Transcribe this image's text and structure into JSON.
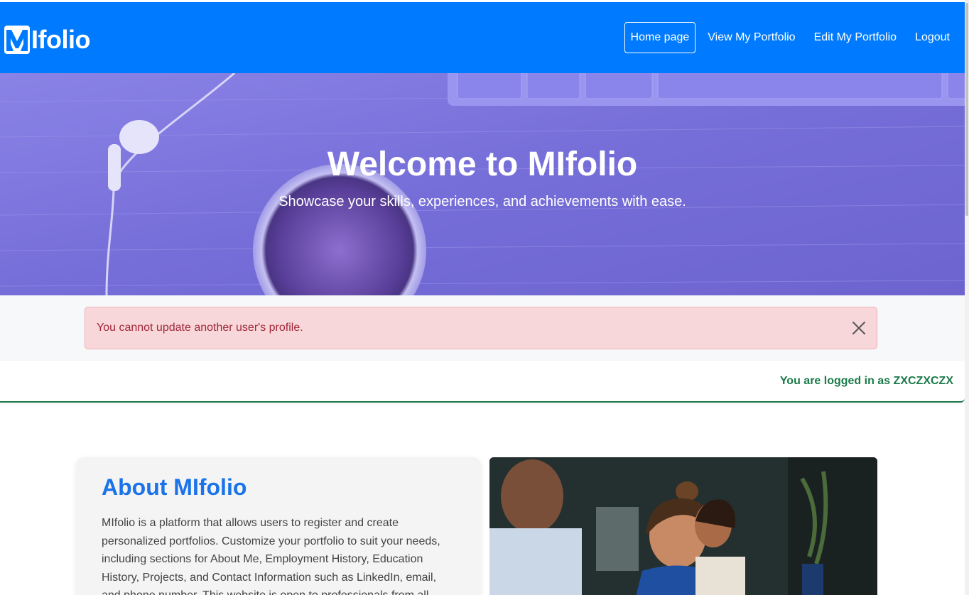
{
  "brand": {
    "logo_letter": "M",
    "logo_text": "Ifolio",
    "accent": "#007bff"
  },
  "nav": {
    "items": [
      {
        "label": "Home page",
        "active": true
      },
      {
        "label": "View My Portfolio",
        "active": false
      },
      {
        "label": "Edit My Portfolio",
        "active": false
      },
      {
        "label": "Logout",
        "active": false
      }
    ]
  },
  "hero": {
    "title": "Welcome to MIfolio",
    "subtitle": "Showcase your skills, experiences, and achievements with ease."
  },
  "alert": {
    "message": "You cannot update another user's profile.",
    "close_icon": "close-icon",
    "color": "#a0283a",
    "background": "#f8d7da"
  },
  "status": {
    "logged_in_text": "You are logged in as ZXCZXCZX",
    "color": "#1b7a4a"
  },
  "about": {
    "title": "About MIfolio",
    "body": "MIfolio is a platform that allows users to register and create personalized portfolios. Customize your portfolio to suit your needs, including sections for About Me, Employment History, Education History, Projects, and Contact Information such as LinkedIn, email, and phone number. This website is open to professionals from all"
  }
}
